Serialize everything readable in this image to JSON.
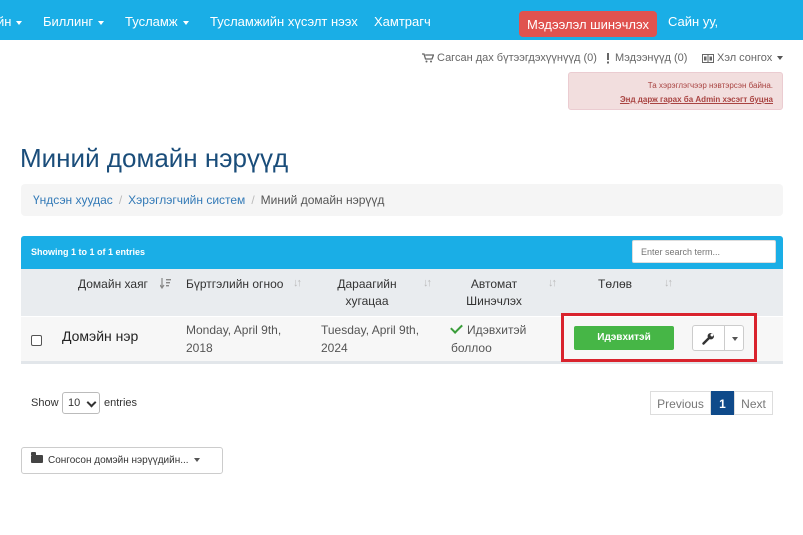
{
  "nav": {
    "items": [
      {
        "label": "йн",
        "caret": true
      },
      {
        "label": "Биллинг",
        "caret": true
      },
      {
        "label": "Тусламж",
        "caret": true
      },
      {
        "label": "Тусламжийн хүсэлт нээх",
        "caret": false
      },
      {
        "label": "Хамтрагч",
        "caret": false
      }
    ],
    "update_button": "Мэдээлэл шинэчлэх",
    "greeting": "Сайн уу,"
  },
  "top_links": {
    "cart": "Сагсан дах бүтээгдэхүүнүүд (0)",
    "notifications": "Мэдээнүүд (0)",
    "language": "Хэл сонгох"
  },
  "alert": {
    "line1": "Та хэрэглэгчээр нэвтэрсэн байна.",
    "line2": "Энд дарж гарах ба Admin хэсэгт буцна"
  },
  "page": {
    "title": "Миний домайн нэрүүд"
  },
  "breadcrumb": {
    "items": [
      "Үндсэн хуудас",
      "Хэрэглэгчийн систем",
      "Миний домайн нэрүүд"
    ]
  },
  "table": {
    "info": "Showing 1 to 1 of 1 entries",
    "search_placeholder": "Enter search term...",
    "headers": {
      "domain": "Домайн хаяг",
      "reg_date": "Бүртгэлийн огноо",
      "next_due_1": "Дараагийн",
      "next_due_2": "хугацаа",
      "auto_renew_1": "Автомат",
      "auto_renew_2": "Шинэчлэх",
      "status": "Төлөв"
    },
    "rows": [
      {
        "domain": "Домэйн нэр",
        "reg_date_1": "Monday, April 9th,",
        "reg_date_2": "2018",
        "next_due_1": "Tuesday, April 9th,",
        "next_due_2": "2024",
        "auto_renew_1": "Идэвхитэй",
        "auto_renew_2": "боллоо",
        "status": "Идэвхитэй"
      }
    ],
    "show_label": "Show",
    "entries_label": "entries",
    "page_length": "10",
    "pagination": {
      "previous": "Previous",
      "current": "1",
      "next": "Next"
    }
  },
  "bulk_action": {
    "label": "Сонгосон домэйн нэрүүдийн..."
  },
  "colors": {
    "nav_bg": "#1aaee6",
    "update_btn": "#e0534f",
    "title": "#1a4d7a",
    "status_active": "#46b646",
    "highlight": "#d9232d",
    "pager_active": "#0f4a8a"
  },
  "icons": [
    "cart-icon",
    "bell-icon",
    "globe-icon",
    "sort-icon",
    "check-icon",
    "wrench-icon",
    "folder-icon",
    "chevron-down-icon"
  ]
}
